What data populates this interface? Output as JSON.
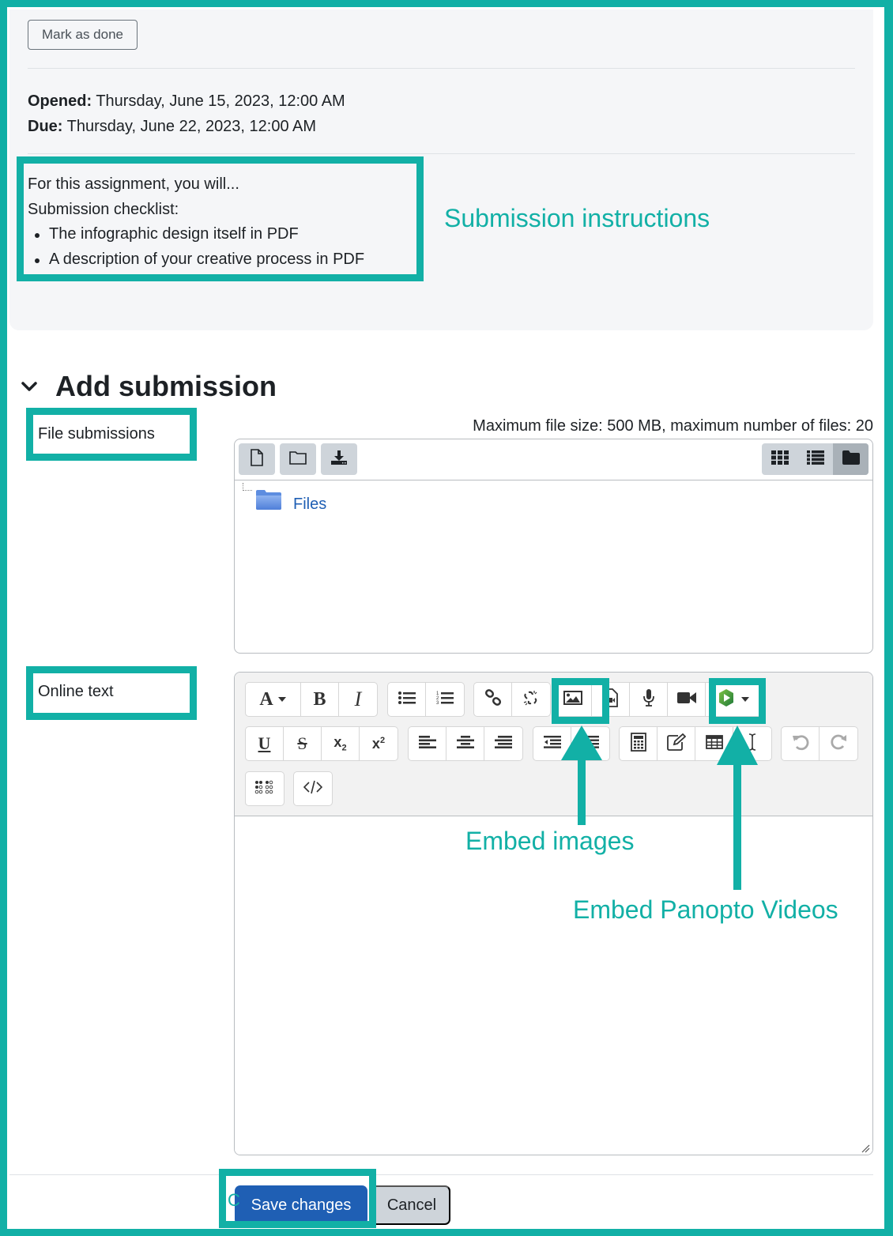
{
  "activity": {
    "mark_done_label": "Mark as done",
    "opened_label": "Opened:",
    "opened_value": "Thursday, June 15, 2023, 12:00 AM",
    "due_label": "Due:",
    "due_value": "Thursday, June 22, 2023, 12:00 AM",
    "intro_line": "For this assignment, you will...",
    "checklist_title": "Submission checklist:",
    "checklist_items": [
      "The infographic design itself in PDF",
      "A description of your creative process in PDF"
    ]
  },
  "annotations": {
    "submission_instructions": "Submission instructions",
    "embed_images": "Embed images",
    "embed_panopto": "Embed Panopto Videos",
    "stray_char": "C",
    "highlight_color": "#12b0a6"
  },
  "submission": {
    "section_title": "Add submission",
    "file_label": "File submissions",
    "file_limits": "Maximum file size: 500 MB, maximum number of files: 20",
    "file_toolbar": [
      "add-file-icon",
      "create-folder-icon",
      "download-icon"
    ],
    "view_modes": [
      "grid-view-icon",
      "list-view-icon",
      "tree-view-icon"
    ],
    "active_view": "tree-view-icon",
    "folder_name": "Files",
    "online_text_label": "Online text",
    "editor_toolbar_row1": [
      "font-style",
      "bold",
      "italic",
      "unordered-list",
      "ordered-list",
      "link",
      "unlink",
      "image",
      "media",
      "record-audio",
      "record-video",
      "panopto"
    ],
    "editor_toolbar_row2": [
      "underline",
      "strikethrough",
      "subscript",
      "superscript",
      "align-left",
      "align-center",
      "align-right",
      "outdent",
      "indent",
      "equation",
      "manage-files",
      "table",
      "clear-formatting",
      "undo",
      "redo"
    ],
    "editor_toolbar_row3": [
      "accessibility-checker",
      "html-source"
    ],
    "editor_value": ""
  },
  "footer": {
    "save_label": "Save changes",
    "cancel_label": "Cancel",
    "save_color": "#1f5fb4"
  }
}
